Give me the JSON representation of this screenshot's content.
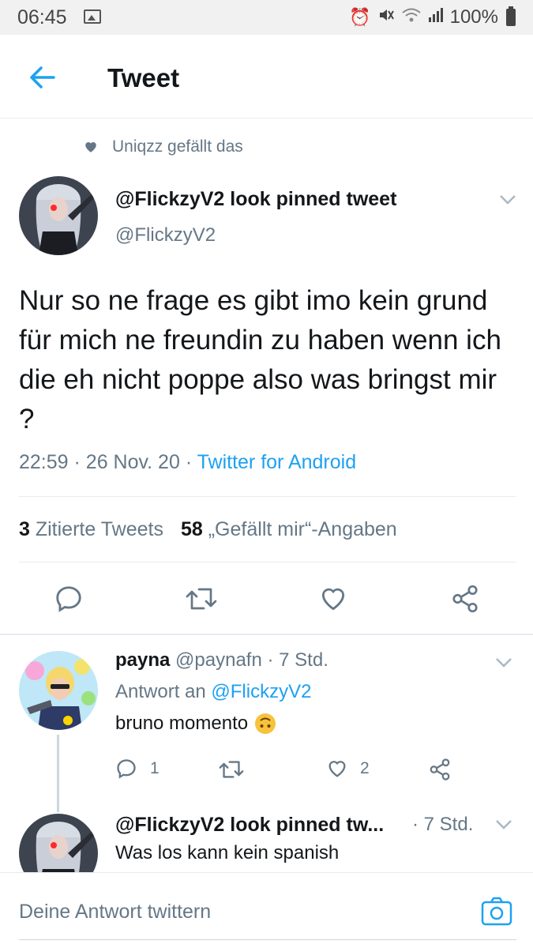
{
  "status_bar": {
    "time": "06:45",
    "battery": "100%"
  },
  "header": {
    "title": "Tweet"
  },
  "social_context": {
    "text": "Uniqzz gefällt das"
  },
  "tweet": {
    "display_name": "@FlickzyV2 look pinned tweet",
    "handle": "@FlickzyV2",
    "text": "Nur so ne frage es gibt imo kein grund für mich ne freundin zu haben wenn ich die eh nicht poppe also was bringst mir ?",
    "time": "22:59",
    "date": "26 Nov. 20",
    "separator": "·",
    "source": "Twitter for Android",
    "quote_count": "3",
    "quote_label": "Zitierte Tweets",
    "like_count": "58",
    "like_label": "„Gefällt mir“-Angaben"
  },
  "reply": {
    "display_name": "payna",
    "handle": "@paynafn",
    "time": "· 7 Std.",
    "reply_prefix": "Antwort an",
    "reply_mention": "@FlickzyV2",
    "text": "bruno momento",
    "reply_count": "1",
    "like_count": "2"
  },
  "reply2": {
    "display_name": "@FlickzyV2 look pinned tw...",
    "time": "· 7 Std.",
    "text": "Was los kann kein spanish"
  },
  "compose": {
    "placeholder": "Deine Antwort twittern"
  },
  "colors": {
    "accent": "#1da1f2",
    "secondary_text": "#657786",
    "primary_text": "#14171a",
    "divider": "#e6ecf0"
  }
}
